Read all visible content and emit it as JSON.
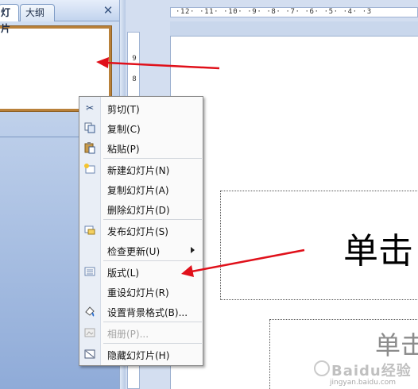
{
  "panel": {
    "tabs": [
      {
        "label": "灯片"
      },
      {
        "label": "大纲"
      }
    ],
    "close_glyph": "✕"
  },
  "ruler": {
    "horizontal": "·12· ·11· ·10· ·9· ·8· ·7· ·6· ·5· ·4· ·3",
    "vertical": [
      "9",
      "8"
    ]
  },
  "slide": {
    "title_text": "单击",
    "subtitle_text": "单击"
  },
  "context_menu": {
    "items": [
      {
        "label": "剪切(T)",
        "icon": "scissors-icon",
        "enabled": true
      },
      {
        "label": "复制(C)",
        "icon": "copy-icon",
        "enabled": true
      },
      {
        "label": "粘贴(P)",
        "icon": "paste-icon",
        "enabled": true
      },
      {
        "label": "新建幻灯片(N)",
        "icon": "new-slide-icon",
        "enabled": true
      },
      {
        "label": "复制幻灯片(A)",
        "icon": "",
        "enabled": true
      },
      {
        "label": "删除幻灯片(D)",
        "icon": "",
        "enabled": true
      },
      {
        "label": "发布幻灯片(S)",
        "icon": "publish-slide-icon",
        "enabled": true
      },
      {
        "label": "检查更新(U)",
        "icon": "",
        "enabled": true,
        "has_submenu": true
      },
      {
        "label": "版式(L)",
        "icon": "layout-icon",
        "enabled": true
      },
      {
        "label": "重设幻灯片(R)",
        "icon": "",
        "enabled": true
      },
      {
        "label": "设置背景格式(B)...",
        "icon": "format-background-icon",
        "enabled": true
      },
      {
        "label": "相册(P)...",
        "icon": "photo-album-icon",
        "enabled": false
      },
      {
        "label": "隐藏幻灯片(H)",
        "icon": "hide-slide-icon",
        "enabled": true
      }
    ]
  },
  "watermark": {
    "title": "Baidu经验",
    "url": "jingyan.baidu.com"
  },
  "colors": {
    "annotation_red": "#e0101a",
    "thumbnail_border": "#b9813a"
  }
}
